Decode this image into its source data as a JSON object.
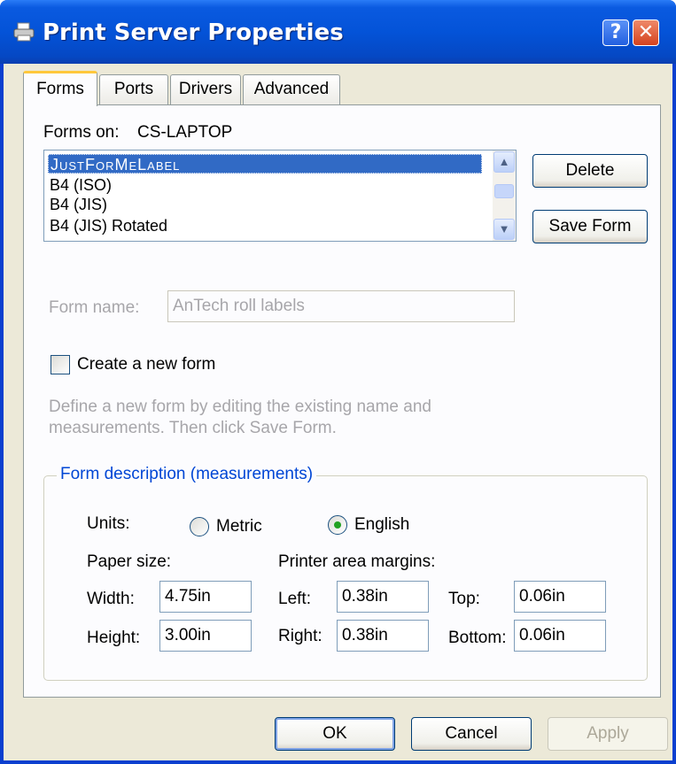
{
  "window": {
    "title": "Print Server Properties",
    "help_glyph": "?",
    "close_glyph": "✕"
  },
  "tabs": [
    {
      "label": "Forms",
      "active": true
    },
    {
      "label": "Ports",
      "active": false
    },
    {
      "label": "Drivers",
      "active": false
    },
    {
      "label": "Advanced",
      "active": false
    }
  ],
  "forms_tab": {
    "forms_on_label": "Forms on:",
    "forms_on_value": "CS-LAPTOP",
    "forms_list": [
      {
        "label": "JustForMeLabel",
        "selected": true
      },
      {
        "label": "B4 (ISO)",
        "selected": false
      },
      {
        "label": "B4 (JIS)",
        "selected": false
      },
      {
        "label": "B4 (JIS) Rotated",
        "selected": false
      }
    ],
    "delete_button": "Delete",
    "save_form_button": "Save Form",
    "form_name_label": "Form name:",
    "form_name_value": "AnTech roll labels",
    "create_new_form_label": "Create a new form",
    "create_new_form_checked": false,
    "hint_line1": "Define a new form by editing the existing name and",
    "hint_line2": "measurements.  Then click Save Form.",
    "description_group": {
      "title": "Form description (measurements)",
      "units_label": "Units:",
      "metric_label": "Metric",
      "english_label": "English",
      "selected_unit": "English",
      "paper_size_label": "Paper size:",
      "printer_margins_label": "Printer area margins:",
      "width_label": "Width:",
      "width_value": "4.75in",
      "height_label": "Height:",
      "height_value": "3.00in",
      "left_label": "Left:",
      "left_value": "0.38in",
      "right_label": "Right:",
      "right_value": "0.38in",
      "top_label": "Top:",
      "top_value": "0.06in",
      "bottom_label": "Bottom:",
      "bottom_value": "0.06in"
    }
  },
  "footer": {
    "ok_button": "OK",
    "cancel_button": "Cancel",
    "apply_button": "Apply"
  },
  "colors": {
    "titlebar": "#0453d8",
    "dialog_bg": "#ece9d8",
    "selection": "#316ac5",
    "group_title": "#0046d5",
    "active_tab_accent": "#ffc83c"
  }
}
